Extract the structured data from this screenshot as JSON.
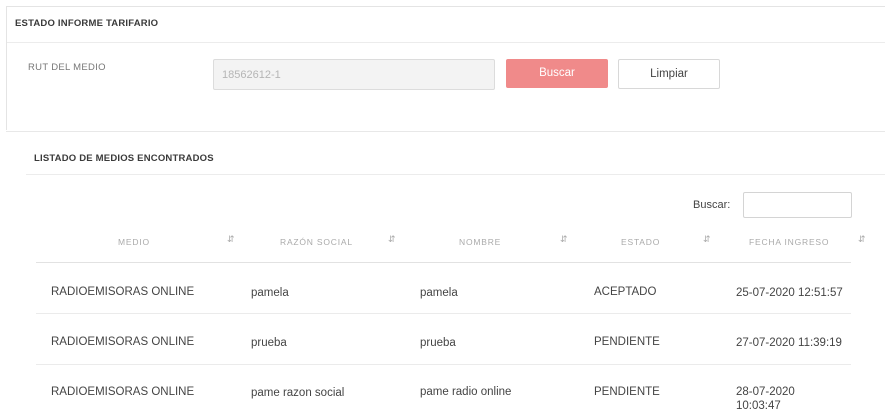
{
  "header": {
    "title": "ESTADO INFORME TARIFARIO"
  },
  "form": {
    "rut_label": "RUT DEL MEDIO",
    "rut_value": "18562612-1",
    "buscar_label": "Buscar",
    "limpiar_label": "Limpiar"
  },
  "listing": {
    "title": "LISTADO DE MEDIOS ENCONTRADOS",
    "search_label": "Buscar:",
    "search_value": "",
    "columns": [
      "MEDIO",
      "RAZÓN SOCIAL",
      "NOMBRE",
      "ESTADO",
      "FECHA INGRESO"
    ],
    "sort_icon": "up-down-sort-icon",
    "rows": [
      {
        "medio": "RADIOEMISORAS ONLINE",
        "razon_social": "pamela",
        "nombre": "pamela",
        "estado": "ACEPTADO",
        "fecha_ingreso": "25-07-2020 12:51:57"
      },
      {
        "medio": "RADIOEMISORAS ONLINE",
        "razon_social": "prueba",
        "nombre": "prueba",
        "estado": "PENDIENTE",
        "fecha_ingreso": "27-07-2020 11:39:19"
      },
      {
        "medio": "RADIOEMISORAS ONLINE",
        "razon_social": "pame razon social",
        "nombre": "pame radio online",
        "estado": "PENDIENTE",
        "fecha_ingreso": "28-07-2020 10:03:47"
      }
    ]
  },
  "colors": {
    "accent": "#f08a8a",
    "border": "#e4e4e4",
    "text": "#444444",
    "muted": "#aaaaaa"
  }
}
